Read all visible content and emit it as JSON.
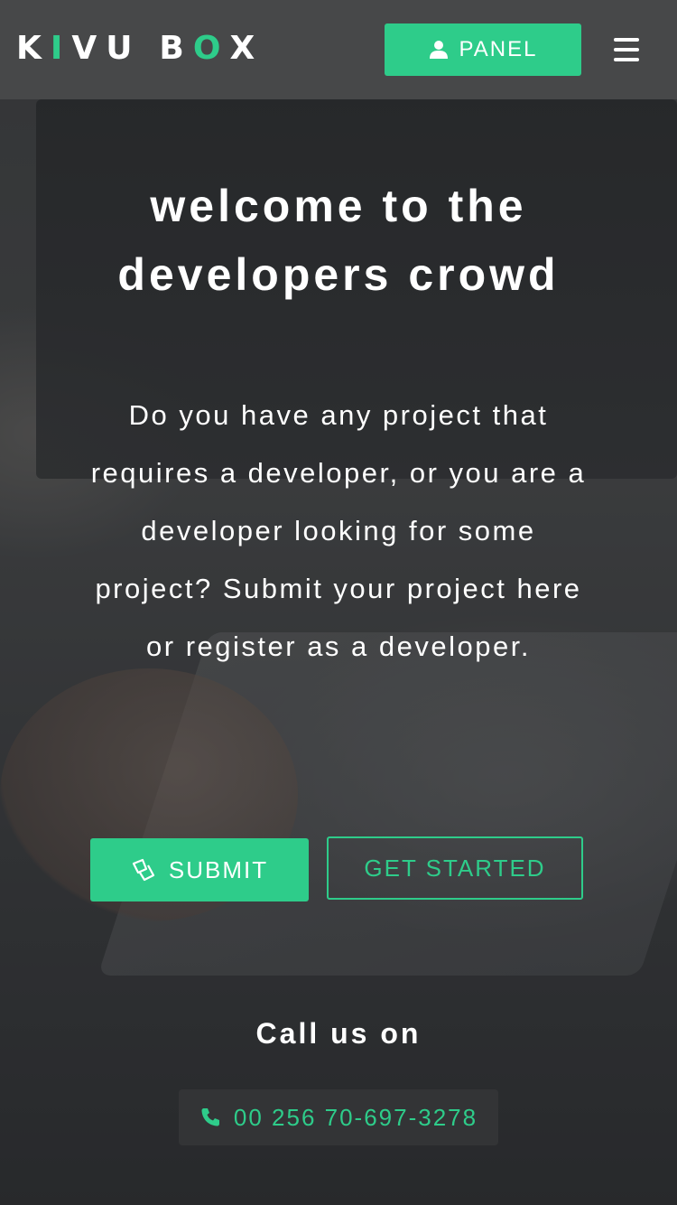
{
  "brand": {
    "letters": [
      {
        "char": "K",
        "accent": false
      },
      {
        "char": "I",
        "accent": true
      },
      {
        "char": "V",
        "accent": false
      },
      {
        "char": "U",
        "accent": false
      },
      {
        "char": " ",
        "accent": false
      },
      {
        "char": "B",
        "accent": false
      },
      {
        "char": "O",
        "accent": true
      },
      {
        "char": "X",
        "accent": false
      }
    ],
    "accent_color": "#2ecc8a"
  },
  "nav": {
    "panel_label": "PANEL",
    "panel_icon": "user-icon",
    "menu_icon": "hamburger-menu-icon"
  },
  "hero": {
    "title_line1": "welcome to the",
    "title_line2": "developers crowd",
    "intro": "Do you have any project that requires a developer, or you are a developer looking for some project? Submit your project here or register as a developer."
  },
  "actions": {
    "submit_label": "SUBMIT",
    "submit_icon": "tag-icon",
    "get_started_label": "GET STARTED"
  },
  "contact": {
    "label": "Call us on",
    "phone": "00 256 70-697-3278",
    "phone_icon": "phone-icon"
  },
  "colors": {
    "accent": "#2ecc8a",
    "navbar": "#474849",
    "phone_box": "#333436"
  }
}
